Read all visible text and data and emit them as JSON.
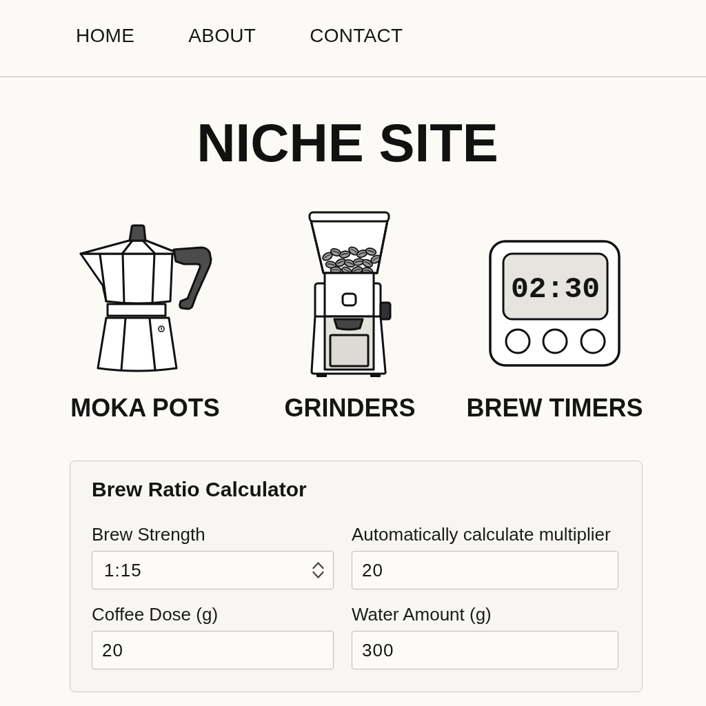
{
  "nav": {
    "items": [
      "HOME",
      "ABOUT",
      "CONTACT"
    ]
  },
  "site_title": "NICHE SITE",
  "categories": [
    {
      "kind": "moka_pot",
      "label": "MOKA POTS"
    },
    {
      "kind": "grinder",
      "label": "GRINDERS"
    },
    {
      "kind": "timer",
      "label": "BREW TIMERS",
      "display": "02:30"
    }
  ],
  "calculator": {
    "title": "Brew Ratio Calculator",
    "fields": [
      {
        "kind": "select",
        "label": "Brew Strength",
        "value": "1:15"
      },
      {
        "kind": "input",
        "label": "Automatically calculate multiplier",
        "value": "20"
      },
      {
        "kind": "input",
        "label": "Coffee Dose (g)",
        "value": "20"
      },
      {
        "kind": "input",
        "label": "Water Amount (g)",
        "value": "300"
      }
    ]
  }
}
